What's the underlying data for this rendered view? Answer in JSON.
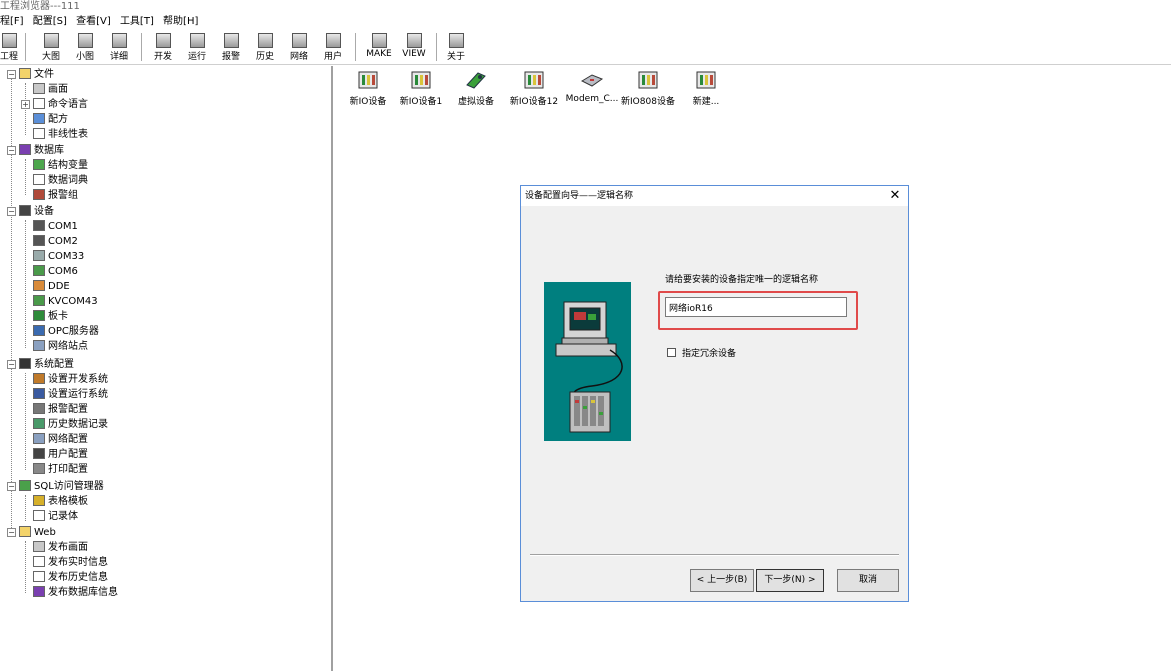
{
  "window": {
    "title": "工程浏览器---111"
  },
  "menu": [
    {
      "label": "程[F]"
    },
    {
      "label": "配置[S]"
    },
    {
      "label": "查看[V]"
    },
    {
      "label": "工具[T]"
    },
    {
      "label": "帮助[H]"
    }
  ],
  "toolbar": {
    "project": "工程",
    "large": "大图",
    "small": "小图",
    "detail": "详细",
    "develop": "开发",
    "run": "运行",
    "alarm": "报警",
    "history": "历史",
    "network": "网络",
    "user": "用户",
    "make": "MAKE",
    "view": "VIEW",
    "about": "关于"
  },
  "tree": {
    "file": "文件",
    "screen": "画面",
    "cmdlang": "命令语言",
    "recipe": "配方",
    "nonlinear": "非线性表",
    "database": "数据库",
    "structvar": "结构变量",
    "dictionary": "数据词典",
    "alarmgroup": "报警组",
    "device": "设备",
    "com1": "COM1",
    "com2": "COM2",
    "com33": "COM33",
    "com6": "COM6",
    "dde": "DDE",
    "kvcom43": "KVCOM43",
    "board": "板卡",
    "opc": "OPC服务器",
    "netnode": "网络站点",
    "sysconfig": "系统配置",
    "setdev": "设置开发系统",
    "setrun": "设置运行系统",
    "alarmcfg": "报警配置",
    "histrec": "历史数据记录",
    "netcfg": "网络配置",
    "usercfg": "用户配置",
    "printcfg": "打印配置",
    "sql": "SQL访问管理器",
    "tabletpl": "表格模板",
    "recordset": "记录体",
    "web": "Web",
    "pubscreen": "发布画面",
    "pubrealtime": "发布实时信息",
    "pubhistory": "发布历史信息",
    "pubdb": "发布数据库信息"
  },
  "devices": [
    {
      "label": "新IO设备"
    },
    {
      "label": "新IO设备1"
    },
    {
      "label": "虚拟设备"
    },
    {
      "label": "新IO设备12"
    },
    {
      "label": "Modem_C..."
    },
    {
      "label": "新IO808设备"
    },
    {
      "label": "新建..."
    }
  ],
  "dialog": {
    "title": "设备配置向导——逻辑名称",
    "close": "✕",
    "prompt": "请给要安装的设备指定唯一的逻辑名称",
    "name_value": "网络ioR16",
    "redundant_label": "指定冗余设备",
    "back": "< 上一步(B)",
    "next": "下一步(N) >",
    "cancel": "取消"
  },
  "colors": {
    "dialog_border": "#5a8ed8",
    "highlight": "#e04a4a",
    "picture_bg": "#007f7f"
  }
}
